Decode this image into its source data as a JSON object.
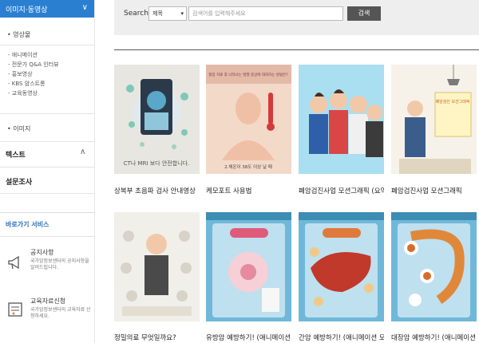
{
  "sidebar": {
    "section_title": "이미지·동영상",
    "video_label": "영상물",
    "sub_items": [
      "- 애니메이션",
      "- 전문가 Q&A 인터뷰",
      "- 홍보영상",
      "- KBS 암스트롱",
      "- 교육동영상"
    ],
    "image_label": "이미지",
    "text_label": "텍스트",
    "survey_label": "설문조사",
    "services_title": "바로가기 서비스",
    "service1_title": "공지사항",
    "service1_desc": "국가암정보센터의 공지사항을 알려드립니다.",
    "service2_title": "교육자료신청",
    "service2_desc": "국가암정보센터의 교육자료 신청하세요."
  },
  "search": {
    "label": "Search",
    "select_value": "제목",
    "placeholder": "검색어를 입력해주세요",
    "button": "검색"
  },
  "thumb_text": {
    "t1": "CT나 MRI 보다 안전합니다.",
    "t2_top": "항암 치료 후 나타나는 발열 증상에 대처하는 방법은?",
    "t2_bottom": "2.체온이 38도 이상 날 때",
    "t4": "폐암검진 모션그래픽"
  },
  "items": [
    {
      "title": "상복부 초음파 검사 안내영상"
    },
    {
      "title": "케모포트 사용법"
    },
    {
      "title": "폐암검진사업 모션그래픽 (요약"
    },
    {
      "title": "폐암검진사업 모션그래픽"
    },
    {
      "title": "정밀의료 무엇일까요?"
    },
    {
      "title": "유방암 예방하기! (애니메이션 !"
    },
    {
      "title": "간암 예방하기! (애니메이션 모!"
    },
    {
      "title": "대장암 예방하기! (애니메이션 !"
    }
  ],
  "colors": {
    "accent": "#2a7fd1",
    "search_bg": "#eeeeee",
    "button": "#555555"
  }
}
